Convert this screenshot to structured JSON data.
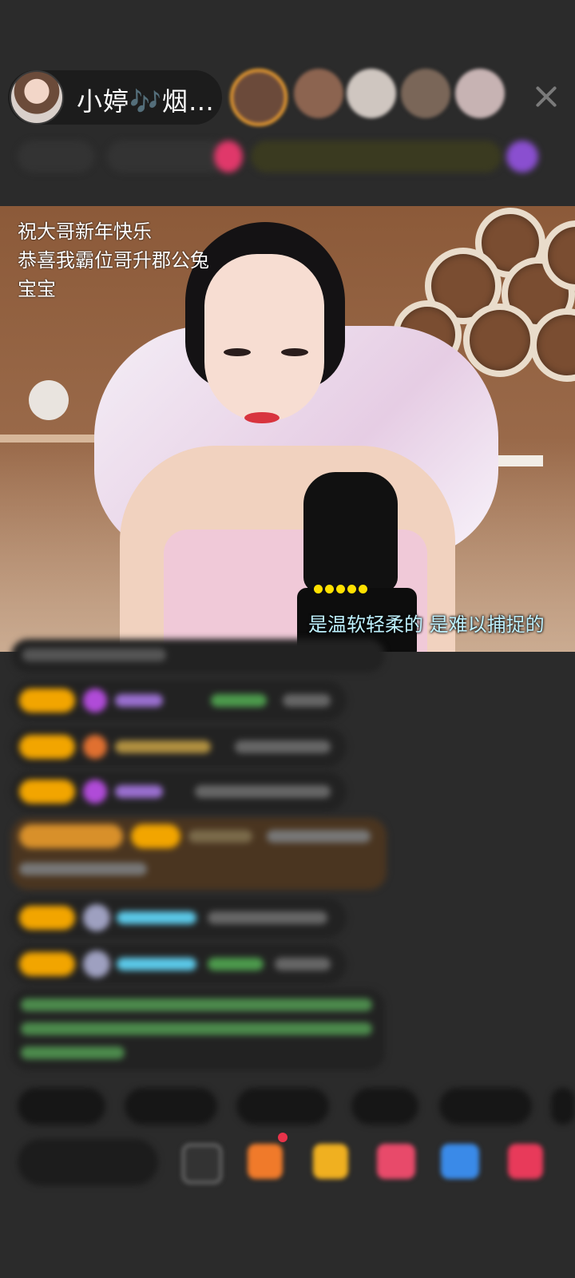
{
  "header": {
    "host_name": "小婷🎶烟…",
    "viewers": [
      {
        "icon": "viewer-avatar-1"
      },
      {
        "icon": "viewer-avatar-2"
      },
      {
        "icon": "viewer-avatar-3"
      },
      {
        "icon": "viewer-avatar-4"
      },
      {
        "icon": "viewer-avatar-5"
      }
    ],
    "close_icon": "close-icon"
  },
  "video": {
    "overlay_lines": [
      "祝大哥新年快乐",
      "恭喜我霸位哥升郡公兔",
      "宝宝"
    ],
    "lyric": "是温软轻柔的 是难以捕捉的"
  },
  "colors": {
    "background": "#2b2b2b",
    "badge": "#f2a500",
    "chat_bubble": "#222222",
    "highlight_bubble": "#4a3520",
    "lyric": "#bff2ff",
    "username_cyan": "#5bc8e8",
    "username_purple": "#b26be0"
  },
  "bottom_bar": {
    "icons": [
      "emoji-icon",
      "gift-box-icon",
      "red-envelope-icon",
      "heart-icon",
      "game-icon",
      "more-grid-icon"
    ]
  }
}
